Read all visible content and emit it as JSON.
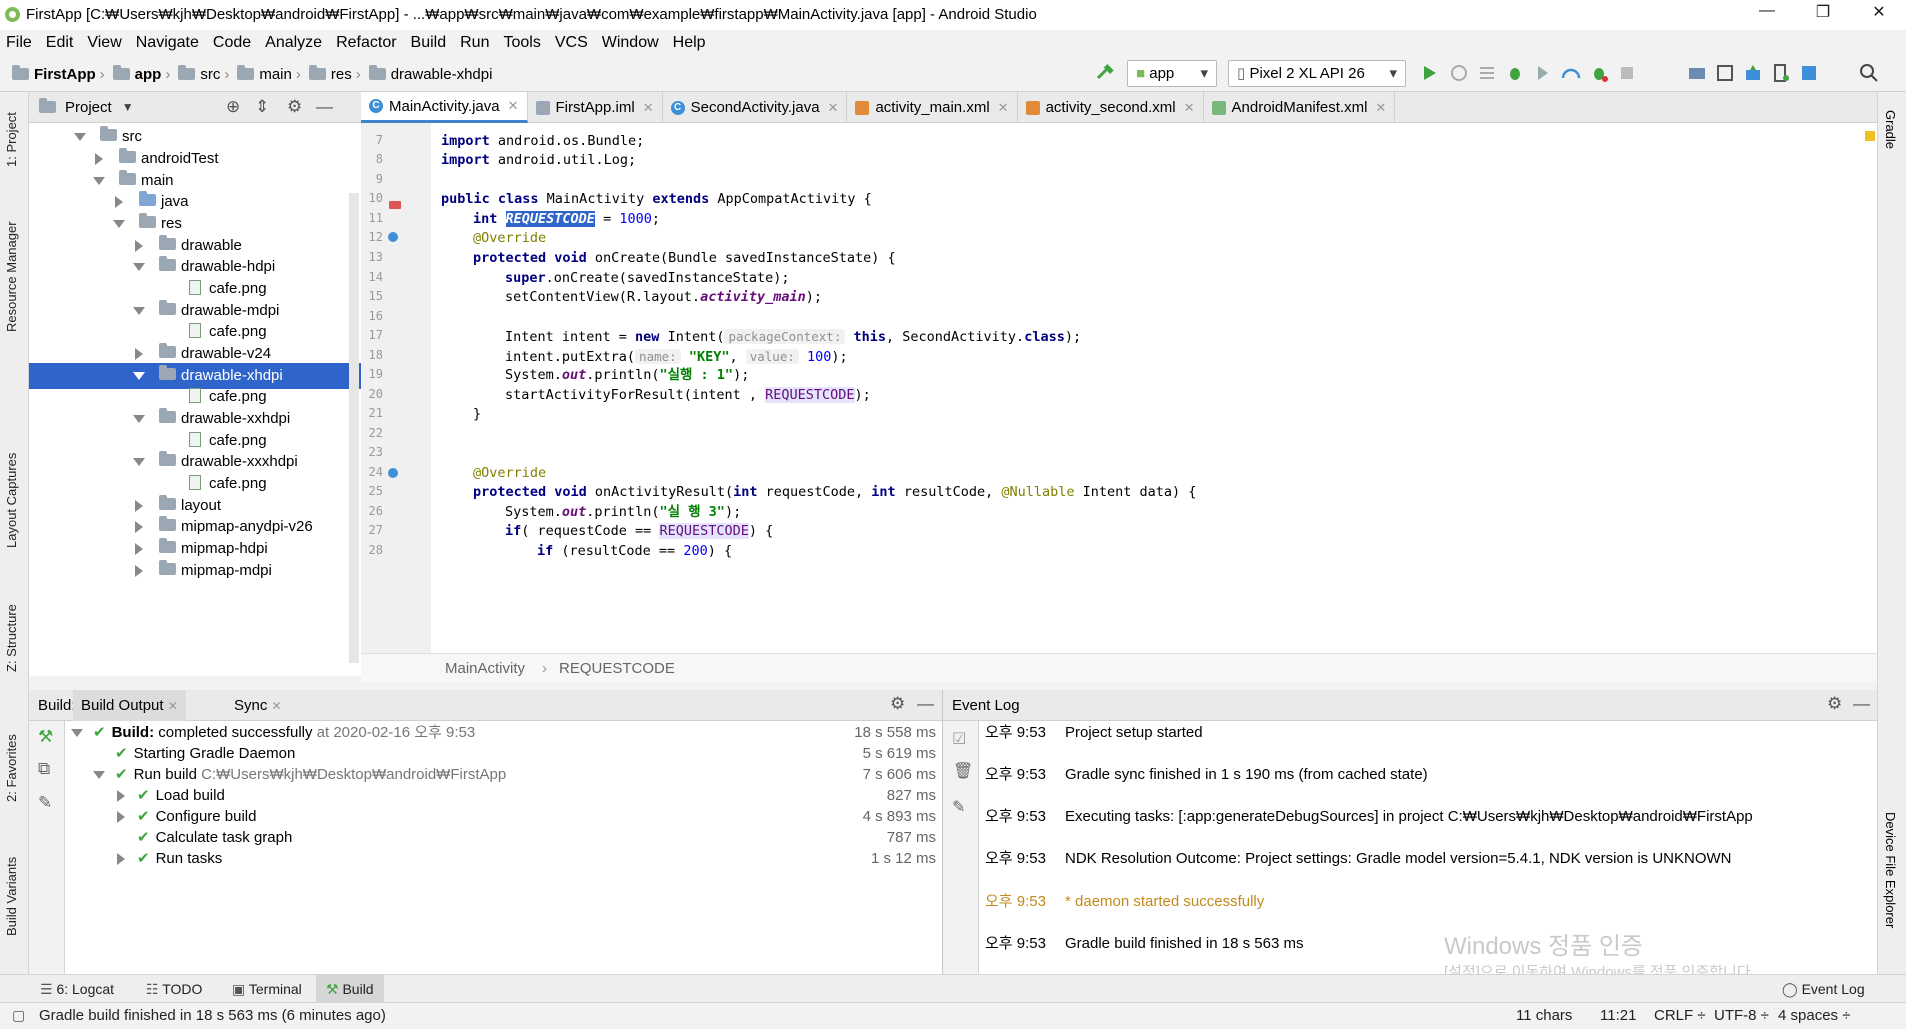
{
  "window": {
    "title": "FirstApp [C:₩Users₩kjh₩Desktop₩android₩FirstApp] - ...₩app₩src₩main₩java₩com₩example₩firstapp₩MainActivity.java [app] - Android Studio"
  },
  "menu": [
    "File",
    "Edit",
    "View",
    "Navigate",
    "Code",
    "Analyze",
    "Refactor",
    "Build",
    "Run",
    "Tools",
    "VCS",
    "Window",
    "Help"
  ],
  "breadcrumb": [
    "FirstApp",
    "app",
    "src",
    "main",
    "res",
    "drawable-xhdpi"
  ],
  "toolbar": {
    "config": "app",
    "device": "Pixel 2 XL API 26"
  },
  "stripes": {
    "left": [
      "1: Project",
      "Resource Manager",
      "Layout Captures",
      "Z: Structure",
      "2: Favorites",
      "Build Variants"
    ],
    "right": [
      "Gradle",
      "Device File Explorer"
    ]
  },
  "project_panel": {
    "title": "Project",
    "tree": [
      {
        "label": "src",
        "type": "folder",
        "open": true
      },
      {
        "label": "androidTest",
        "type": "folder",
        "open": false
      },
      {
        "label": "main",
        "type": "folder",
        "open": true
      },
      {
        "label": "java",
        "type": "folder-blue",
        "open": false
      },
      {
        "label": "res",
        "type": "folder",
        "open": true
      },
      {
        "label": "drawable",
        "type": "folder",
        "open": false
      },
      {
        "label": "drawable-hdpi",
        "type": "folder",
        "open": true
      },
      {
        "label": "cafe.png",
        "type": "file"
      },
      {
        "label": "drawable-mdpi",
        "type": "folder",
        "open": true
      },
      {
        "label": "cafe.png",
        "type": "file"
      },
      {
        "label": "drawable-v24",
        "type": "folder",
        "open": false
      },
      {
        "label": "drawable-xhdpi",
        "type": "folder",
        "open": true,
        "selected": true
      },
      {
        "label": "cafe.png",
        "type": "file"
      },
      {
        "label": "drawable-xxhdpi",
        "type": "folder",
        "open": true
      },
      {
        "label": "cafe.png",
        "type": "file"
      },
      {
        "label": "drawable-xxxhdpi",
        "type": "folder",
        "open": true
      },
      {
        "label": "cafe.png",
        "type": "file"
      },
      {
        "label": "layout",
        "type": "folder",
        "open": false
      },
      {
        "label": "mipmap-anydpi-v26",
        "type": "folder",
        "open": false
      },
      {
        "label": "mipmap-hdpi",
        "type": "folder",
        "open": false
      },
      {
        "label": "mipmap-mdpi",
        "type": "folder",
        "open": false
      }
    ]
  },
  "editor_tabs": [
    {
      "label": "MainActivity.java",
      "icon": "class-icon",
      "active": true
    },
    {
      "label": "FirstApp.iml",
      "icon": "iml-icon"
    },
    {
      "label": "SecondActivity.java",
      "icon": "class-icon"
    },
    {
      "label": "activity_main.xml",
      "icon": "xml-icon"
    },
    {
      "label": "activity_second.xml",
      "icon": "xml-icon"
    },
    {
      "label": "AndroidManifest.xml",
      "icon": "manifest-icon"
    }
  ],
  "code": {
    "line_numbers": [
      "7",
      "8",
      "9",
      "10",
      "11",
      "12",
      "13",
      "14",
      "15",
      "16",
      "17",
      "18",
      "19",
      "20",
      "21",
      "22",
      "23",
      "24",
      "25",
      "26",
      "27",
      "28"
    ],
    "l7a": "import",
    "l7b": " android.os.Bundle;",
    "l8a": "import",
    "l8b": " android.util.Log;",
    "l10a": "public class",
    "l10b": " MainActivity ",
    "l10c": "extends",
    "l10d": " AppCompatActivity {",
    "l11a": "int",
    "l11b": "REQUESTCODE",
    "l11c": " = ",
    "l11d": "1000",
    "l11e": ";",
    "l12": "@Override",
    "l13a": "protected void",
    "l13b": " onCreate(Bundle savedInstanceState) {",
    "l14a": "super",
    "l14b": ".onCreate(savedInstanceState);",
    "l15a": "setContentView(R.layout.",
    "l15b": "activity_main",
    "l15c": ");",
    "l17a": "Intent intent = ",
    "l17b": "new",
    "l17c": " Intent(",
    "l17d": "packageContext:",
    "l17e": "this",
    "l17f": ", SecondActivity.",
    "l17g": "class",
    "l17h": ");",
    "l18a": "intent.putExtra(",
    "l18b": "name:",
    "l18c": "\"KEY\"",
    "l18d": ", ",
    "l18e": "value:",
    "l18f": "100",
    "l18g": ");",
    "l19a": "System.",
    "l19b": "out",
    "l19c": ".println(",
    "l19d": "\"실행 : 1\"",
    "l19e": ");",
    "l20a": "startActivityForResult(intent , ",
    "l20b": "REQUESTCODE",
    "l20c": ");",
    "l21": "}",
    "l24": "@Override",
    "l25a": "protected void",
    "l25b": " onActivityResult(",
    "l25c": "int",
    "l25d": " requestCode, ",
    "l25e": "int",
    "l25f": " resultCode, ",
    "l25g": "@Nullable",
    "l25h": " Intent data) {",
    "l26a": "System.",
    "l26b": "out",
    "l26c": ".println(",
    "l26d": "\"실 행 3\"",
    "l26e": ");",
    "l27a": "if",
    "l27b": "( requestCode == ",
    "l27c": "REQUESTCODE",
    "l27d": ") {",
    "l28a": "if",
    "l28b": " (resultCode == ",
    "l28c": "200",
    "l28d": ") {"
  },
  "editor_breadcrumb": [
    "MainActivity",
    "REQUESTCODE"
  ],
  "build_panel": {
    "tabs": [
      "Build:",
      "Build Output",
      "Sync"
    ],
    "rows": [
      {
        "label_bold": "Build:",
        "label": " completed successfully",
        "extra": " at 2020-02-16 오후 9:53",
        "time": "18 s 558 ms"
      },
      {
        "label": "Starting Gradle Daemon",
        "time": "5 s 619 ms"
      },
      {
        "label": "Run build",
        "extra": " C:₩Users₩kjh₩Desktop₩android₩FirstApp",
        "time": "7 s 606 ms"
      },
      {
        "label": "Load build",
        "time": "827 ms"
      },
      {
        "label": "Configure build",
        "time": "4 s 893 ms"
      },
      {
        "label": "Calculate task graph",
        "time": "787 ms"
      },
      {
        "label": "Run tasks",
        "time": "1 s 12 ms"
      }
    ]
  },
  "event_log": {
    "title": "Event Log",
    "entries": [
      {
        "time": "오후 9:53",
        "text": "Project setup started"
      },
      {
        "time": "오후 9:53",
        "text": "Gradle sync finished in 1 s 190 ms (from cached state)"
      },
      {
        "time": "오후 9:53",
        "text": "Executing tasks: [:app:generateDebugSources] in project C:₩Users₩kjh₩Desktop₩android₩FirstApp"
      },
      {
        "time": "오후 9:53",
        "text": "NDK Resolution Outcome: Project settings: Gradle model version=5.4.1, NDK version is UNKNOWN"
      },
      {
        "time": "오후 9:53",
        "text": "* daemon started successfully",
        "warn": true
      },
      {
        "time": "오후 9:53",
        "text": "Gradle build finished in 18 s 563 ms"
      }
    ]
  },
  "bottom_tabs": [
    "6: Logcat",
    "TODO",
    "Terminal",
    "Build",
    "Event Log"
  ],
  "watermark": {
    "line1": "Windows 정품 인증",
    "line2": "[설정]으로 이동하여 Windows를 정품 인증합니다."
  },
  "status": {
    "message": "Gradle build finished in 18 s 563 ms (6 minutes ago)",
    "chars": "11 chars",
    "position": "11:21",
    "line_sep": "CRLF ÷",
    "encoding": "UTF-8 ÷",
    "indent": "4 spaces ÷"
  },
  "colors": {
    "selection": "#2f65ca",
    "keyword": "#000080",
    "string": "#008000",
    "number": "#0000ff",
    "check": "#3fa33f"
  }
}
